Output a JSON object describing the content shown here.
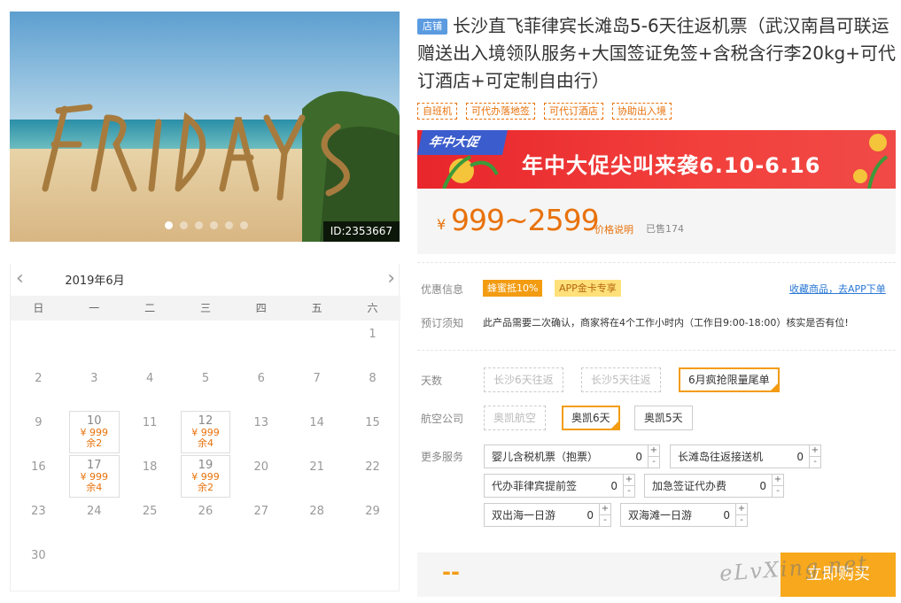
{
  "gallery": {
    "photo_word": "FRIDAYS",
    "id_label": "ID:2353667",
    "dots": 6,
    "active_dot": 1
  },
  "calendar": {
    "month": "2019年6月",
    "weekdays": [
      "日",
      "一",
      "二",
      "三",
      "四",
      "五",
      "六"
    ],
    "rows": [
      [
        {
          "d": ""
        },
        {
          "d": ""
        },
        {
          "d": ""
        },
        {
          "d": ""
        },
        {
          "d": ""
        },
        {
          "d": ""
        },
        {
          "d": "1"
        }
      ],
      [
        {
          "d": "2"
        },
        {
          "d": "3"
        },
        {
          "d": "4"
        },
        {
          "d": "5"
        },
        {
          "d": "6"
        },
        {
          "d": "7"
        },
        {
          "d": "8"
        }
      ],
      [
        {
          "d": "9"
        },
        {
          "d": "10",
          "p": "¥ 999",
          "r": "余2"
        },
        {
          "d": "11"
        },
        {
          "d": "12",
          "p": "¥ 999",
          "r": "余4"
        },
        {
          "d": "13"
        },
        {
          "d": "14"
        },
        {
          "d": "15"
        }
      ],
      [
        {
          "d": "16"
        },
        {
          "d": "17",
          "p": "¥ 999",
          "r": "余4"
        },
        {
          "d": "18"
        },
        {
          "d": "19",
          "p": "¥ 999",
          "r": "余2"
        },
        {
          "d": "20"
        },
        {
          "d": "21"
        },
        {
          "d": "22"
        }
      ],
      [
        {
          "d": "23"
        },
        {
          "d": "24"
        },
        {
          "d": "25"
        },
        {
          "d": "26"
        },
        {
          "d": "27"
        },
        {
          "d": "28"
        },
        {
          "d": "29"
        }
      ],
      [
        {
          "d": "30"
        },
        {
          "d": ""
        },
        {
          "d": ""
        },
        {
          "d": ""
        },
        {
          "d": ""
        },
        {
          "d": ""
        },
        {
          "d": ""
        }
      ]
    ]
  },
  "product": {
    "shop_tag": "店铺",
    "title": "长沙直飞菲律宾长滩岛5-6天往返机票（武汉南昌可联运 赠送出入境领队服务+大国签证免签+含税含行李20kg+可代订酒店+可定制自由行）",
    "tags": [
      "自班机",
      "可代办落地签",
      "可代订酒店",
      "协助出入境"
    ]
  },
  "promo": {
    "badge": "年中大促",
    "text": "年中大促尖叫来袭6.10-6.16"
  },
  "price": {
    "currency": "¥",
    "value": "999~2599",
    "note": "价格说明",
    "sold": "已售174"
  },
  "discount": {
    "label": "优惠信息",
    "pill1": "蜂蜜抵10%",
    "pill2": "APP金卡专享",
    "fav": "收藏商品，去APP下单"
  },
  "booking": {
    "label": "预订须知",
    "text": "此产品需要二次确认，商家将在4个工作小时内（工作日9:00-18:00）核实是否有位!"
  },
  "days": {
    "label": "天数",
    "options": [
      "长沙6天往返",
      "长沙5天往返",
      "6月疯抢限量尾单"
    ]
  },
  "airline": {
    "label": "航空公司",
    "options": [
      "奥凯航空",
      "奥凯6天",
      "奥凯5天"
    ]
  },
  "services": {
    "label": "更多服务",
    "items": [
      {
        "name": "婴儿含税机票（抱票）",
        "qty": "0"
      },
      {
        "name": "长滩岛往返接送机",
        "qty": "0"
      },
      {
        "name": "代办菲律宾提前签",
        "qty": "0"
      },
      {
        "name": "加急签证代办费",
        "qty": "0"
      },
      {
        "name": "双出海一日游",
        "qty": "0"
      },
      {
        "name": "双海滩一日游",
        "qty": "0"
      }
    ],
    "plus": "+",
    "minus": "-"
  },
  "buy": {
    "total": "--",
    "button": "立即购买",
    "watermark": "eLvXing.net"
  },
  "colors": {
    "accent": "#f39c12",
    "price": "#e8720c",
    "promo_red": "#e8262c",
    "link": "#2a78d4"
  }
}
